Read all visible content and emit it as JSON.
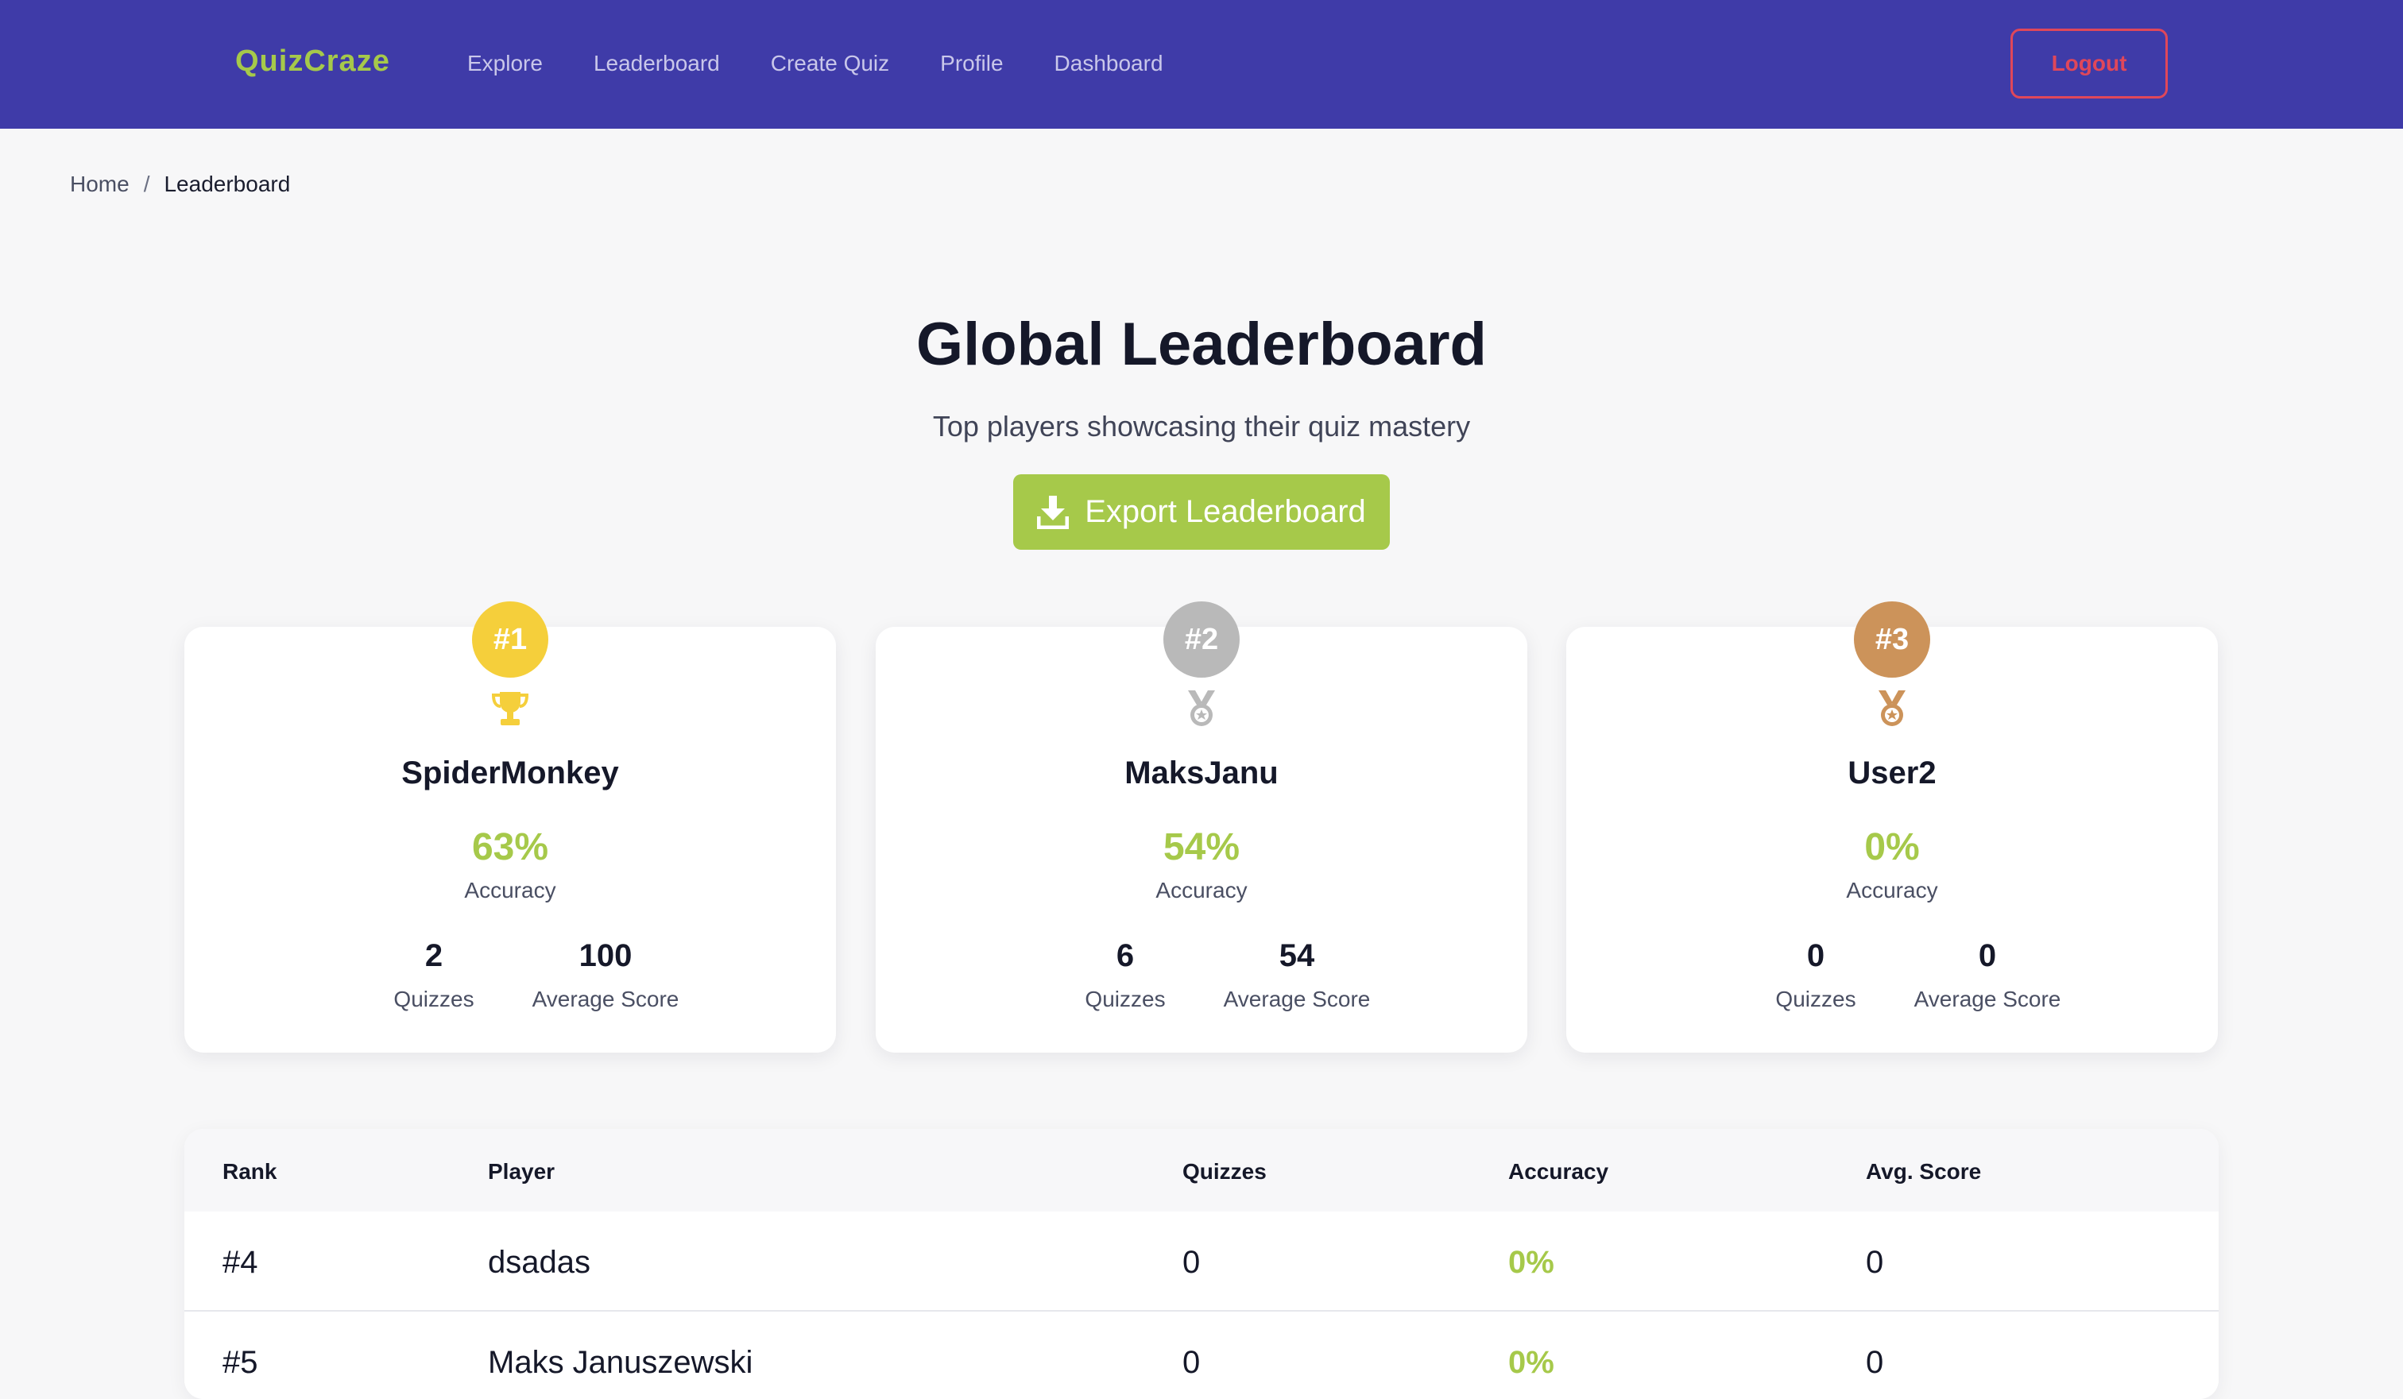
{
  "navbar": {
    "brand": "QuizCraze",
    "links": [
      "Explore",
      "Leaderboard",
      "Create Quiz",
      "Profile",
      "Dashboard"
    ],
    "logout_label": "Logout"
  },
  "breadcrumb": {
    "home": "Home",
    "separator": "/",
    "current": "Leaderboard"
  },
  "header": {
    "title": "Global Leaderboard",
    "subtitle": "Top players showcasing their quiz mastery",
    "export_label": "Export Leaderboard",
    "export_icon": "download-icon"
  },
  "colors": {
    "navbar": "#3f3ba8",
    "brand": "#a6c94a",
    "accent_green": "#a6c94a",
    "logout": "#e0475a",
    "gold": "#f5cf3b",
    "silver": "#b9b9b9",
    "bronze": "#cc935a"
  },
  "podium": [
    {
      "rank": "#1",
      "icon": "trophy-icon",
      "name": "SpiderMonkey",
      "accuracy": "63%",
      "accuracy_label": "Accuracy",
      "quizzes": "2",
      "quizzes_label": "Quizzes",
      "avg_score": "100",
      "avg_score_label": "Average Score"
    },
    {
      "rank": "#2",
      "icon": "medal-icon",
      "name": "MaksJanu",
      "accuracy": "54%",
      "accuracy_label": "Accuracy",
      "quizzes": "6",
      "quizzes_label": "Quizzes",
      "avg_score": "54",
      "avg_score_label": "Average Score"
    },
    {
      "rank": "#3",
      "icon": "medal-icon",
      "name": "User2",
      "accuracy": "0%",
      "accuracy_label": "Accuracy",
      "quizzes": "0",
      "quizzes_label": "Quizzes",
      "avg_score": "0",
      "avg_score_label": "Average Score"
    }
  ],
  "table": {
    "columns": [
      "Rank",
      "Player",
      "Quizzes",
      "Accuracy",
      "Avg. Score"
    ],
    "rows": [
      {
        "rank": "#4",
        "player": "dsadas",
        "quizzes": "0",
        "accuracy": "0%",
        "avg_score": "0"
      },
      {
        "rank": "#5",
        "player": "Maks Januszewski",
        "quizzes": "0",
        "accuracy": "0%",
        "avg_score": "0"
      }
    ]
  }
}
